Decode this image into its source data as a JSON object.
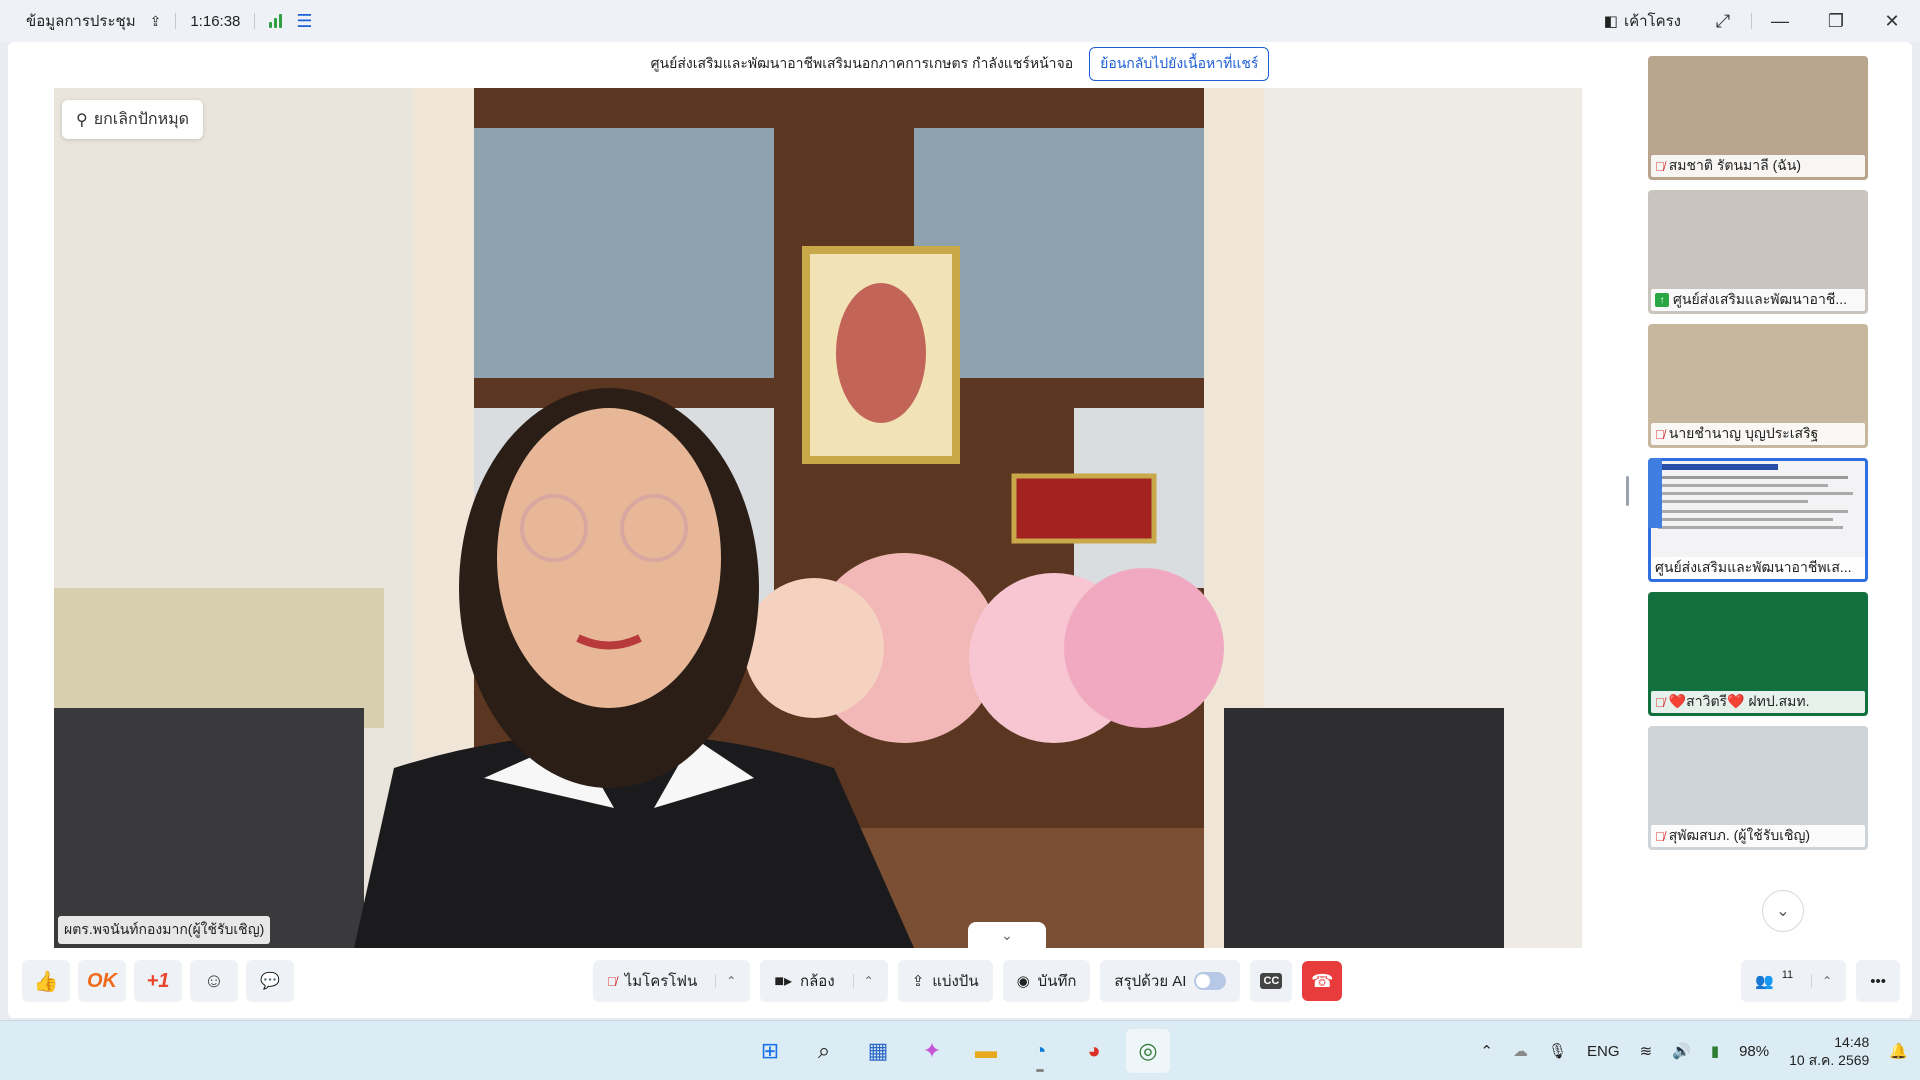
{
  "titlebar": {
    "meeting_info": "ข้อมูลการประชุม",
    "duration": "1:16:38",
    "layout_label": "เค้าโครง"
  },
  "banner": {
    "text": "ศูนย์ส่งเสริมและพัฒนาอาชีพเสริมนอกภาคการเกษตร กำลังแชร์หน้าจอ",
    "back_label": "ย้อนกลับไปยังเนื้อหาที่แชร์"
  },
  "stage": {
    "unpin_label": "ยกเลิกปักหมุด",
    "speaker_name": "ผตร.พจนันท์กองมาก(ผู้ใช้รับเชิญ)"
  },
  "gallery": {
    "tiles": [
      {
        "name": "สมชาติ รัตนมาลี (ฉัน)",
        "mic": "off",
        "bg": "#b9a48e"
      },
      {
        "name": "ศูนย์ส่งเสริมและพัฒนาอาชี...",
        "mic": "share",
        "bg": "#c9c4bd"
      },
      {
        "name": "นายชำนาญ บุญประเสริฐ",
        "mic": "off",
        "bg": "#c8b79f"
      },
      {
        "name": "ศูนย์ส่งเสริมและพัฒนาอาชีพเส...",
        "mic": "none",
        "bg": "#f3f3f6"
      },
      {
        "name": "❤️สาวิตรี❤️ ฝทป.สมท.",
        "mic": "off",
        "bg": "#12703f"
      },
      {
        "name": "สุพัฒสบภ. (ผู้ใช้รับเชิญ)",
        "mic": "off",
        "bg": "#cfd4d8"
      }
    ]
  },
  "controls": {
    "reactions": [
      "👍",
      "OK",
      "+1",
      "☺",
      "💬"
    ],
    "mic_label": "ไมโครโฟน",
    "camera_label": "กล้อง",
    "share_label": "แบ่งปัน",
    "record_label": "บันทึก",
    "ai_summary_label": "สรุปด้วย AI",
    "cc_label": "CC",
    "participants_count": "11"
  },
  "taskbar": {
    "lang": "ENG",
    "battery": "98%",
    "time": "14:48",
    "date": "10 ส.ค. 2569"
  },
  "colors": {
    "accent": "#1f5fd6",
    "end_call": "#e83b3b",
    "mic_off": "#d83b3b",
    "signal": "#2ea043"
  }
}
